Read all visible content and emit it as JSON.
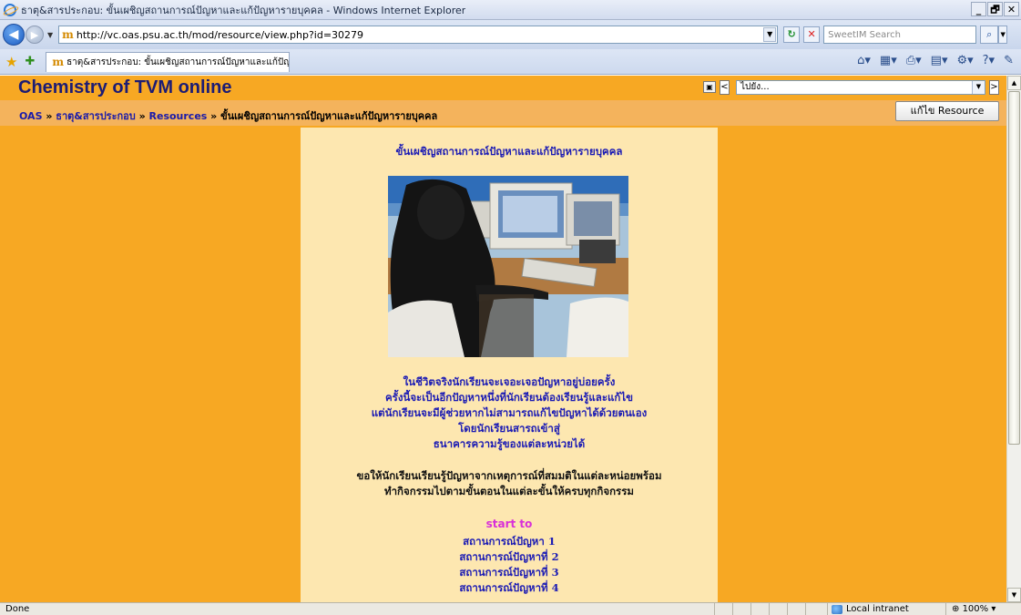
{
  "window": {
    "title": "ธาตุ&สารประกอบ: ขั้นเผชิญสถานการณ์ปัญหาและแก้ปัญหารายบุคคล - Windows Internet Explorer",
    "min": "_",
    "max": "🗗",
    "close": "✕"
  },
  "address": {
    "url": "http://vc.oas.psu.ac.th/mod/resource/view.php?id=30279",
    "search_placeholder": "SweetIM Search"
  },
  "tab": {
    "label": "ธาตุ&สารประกอบ: ขั้นเผชิญสถานการณ์ปัญหาและแก้ปัญ..."
  },
  "site": {
    "title": "Chemistry of TVM online",
    "jump_label": "ไปยัง...",
    "edit_button": "แก้ไข Resource",
    "breadcrumb": {
      "oas": "OAS",
      "course": "ธาตุ&สารประกอบ",
      "resources": "Resources",
      "current": "ขั้นเผชิญสถานการณ์ปัญหาและแก้ปัญหารายบุคคล",
      "sep": " » "
    }
  },
  "content": {
    "heading": "ขั้นเผชิญสถานการณ์ปัญหาและแก้ปัญหารายบุคคล",
    "intro": [
      "ในชีวิตจริงนักเรียนจะเจอะเจอปัญหาอยู่บ่อยครั้ง",
      "ครั้งนี้จะเป็นอีกปัญหาหนึ่งที่นักเรียนต้องเรียนรู้และแก้ไข",
      "แต่นักเรียนจะมีผู้ช่วยหากไม่สามารถแก้ไขปัญหาได้ด้วยตนเอง",
      "โดยนักเรียนสารถเข้าสู่",
      "ธนาคารความรู้ของแต่ละหน่วยได้"
    ],
    "instruction": [
      "ขอให้นักเรียนเรียนรู้ปัญหาจากเหตุการณ์ที่สมมติในแต่ละหน่อยพร้อม",
      "ทำกิจกรรมไปตามขั้นตอนในแต่ละขั้นให้ครบทุกกิจกรรม"
    ],
    "start_label": "start to",
    "links": [
      "สถานการณ์ปัญหา 1",
      "สถานการณ์ปัญหาที่  2",
      "สถานการณ์ปัญหาที่  3",
      "สถานการณ์ปัญหาที่  4"
    ]
  },
  "status": {
    "text": "Done",
    "zone": "Local intranet",
    "zoom": "100%"
  }
}
